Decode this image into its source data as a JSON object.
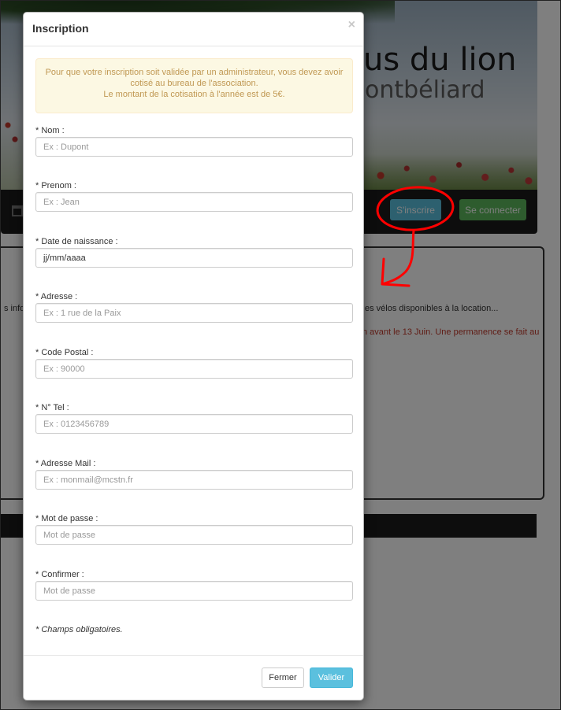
{
  "background": {
    "banner_title": "us du lion",
    "banner_subtitle": "ontbéliard",
    "nav_buttons": {
      "register": "S'inscrire",
      "login": "Se connecter"
    },
    "text_info": "s infor",
    "text_bikes": "es vélos disponibles à la location...",
    "text_deadline": "n avant le 13 Juin. Une permanence se fait au",
    "colors": {
      "register_btn": "#5bc0de",
      "login_btn": "#5cb85c",
      "annotation": "#ff0000"
    }
  },
  "modal": {
    "title": "Inscription",
    "close_symbol": "×",
    "alert": {
      "line1": "Pour que votre inscription soit validée par un administrateur, vous devez avoir",
      "line2": "cotisé au bureau de l'association.",
      "line3": "Le montant de la cotisation à l'année est de 5€."
    },
    "fields": [
      {
        "label": "* Nom :",
        "placeholder": "Ex : Dupont",
        "value": ""
      },
      {
        "label": "* Prenom :",
        "placeholder": "Ex : Jean",
        "value": ""
      },
      {
        "label": "* Date de naissance :",
        "placeholder": "",
        "value": "jj/mm/aaaa"
      },
      {
        "label": "* Adresse :",
        "placeholder": "Ex : 1 rue de la Paix",
        "value": ""
      },
      {
        "label": "* Code Postal :",
        "placeholder": "Ex : 90000",
        "value": ""
      },
      {
        "label": "* N° Tel :",
        "placeholder": "Ex : 0123456789",
        "value": ""
      },
      {
        "label": "* Adresse Mail :",
        "placeholder": "Ex : monmail@mcstn.fr",
        "value": ""
      },
      {
        "label": "* Mot de passe :",
        "placeholder": "Mot de passe",
        "value": ""
      },
      {
        "label": "* Confirmer :",
        "placeholder": "Mot de passe",
        "value": ""
      }
    ],
    "required_note": "* Champs obligatoires.",
    "footer": {
      "close_label": "Fermer",
      "submit_label": "Valider"
    }
  }
}
